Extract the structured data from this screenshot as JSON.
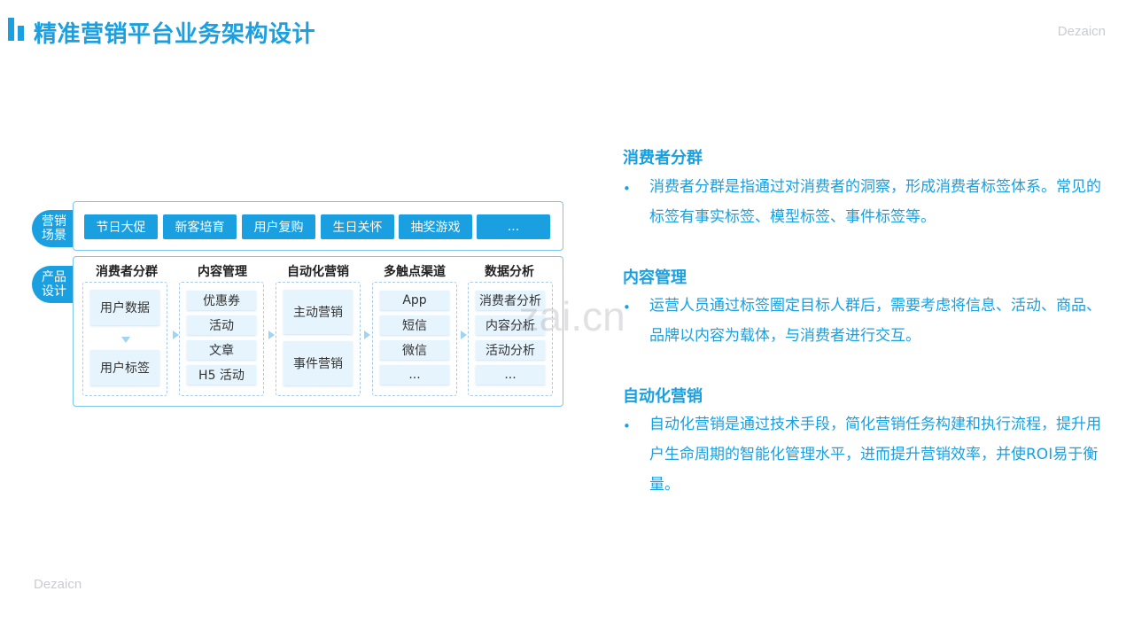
{
  "header": {
    "title": "精准营销平台业务架构设计",
    "brand": "Dezaicn"
  },
  "footer": {
    "brand": "Dezaicn"
  },
  "watermark": "..zai.cn",
  "diagram": {
    "scene_tag": "营销场景",
    "product_tag": "产品设计",
    "scenes": [
      "节日大促",
      "新客培育",
      "用户复购",
      "生日关怀",
      "抽奖游戏",
      "..."
    ],
    "columns": [
      {
        "title": "消费者分群",
        "items": [
          "用户数据",
          "用户标签"
        ]
      },
      {
        "title": "内容管理",
        "items": [
          "优惠券",
          "活动",
          "文章",
          "H5 活动"
        ]
      },
      {
        "title": "自动化营销",
        "items": [
          "主动营销",
          "事件营销"
        ]
      },
      {
        "title": "多触点渠道",
        "items": [
          "App",
          "短信",
          "微信",
          "..."
        ]
      },
      {
        "title": "数据分析",
        "items": [
          "消费者分析",
          "内容分析",
          "活动分析",
          "..."
        ]
      }
    ]
  },
  "sections": [
    {
      "title": "消费者分群",
      "bullet": "•",
      "text": "消费者分群是指通过对消费者的洞察，形成消费者标签体系。常见的标签有事实标签、模型标签、事件标签等。"
    },
    {
      "title": "内容管理",
      "bullet": "•",
      "text": "运营人员通过标签圈定目标人群后，需要考虑将信息、活动、商品、品牌以内容为载体，与消费者进行交互。"
    },
    {
      "title": "自动化营销",
      "bullet": "•",
      "text": "自动化营销是通过技术手段，简化营销任务构建和执行流程，提升用户生命周期的智能化管理水平，进而提升营销效率，并使ROI易于衡量。"
    }
  ],
  "colors": {
    "accent": "#1a9fe0",
    "cell": "#e6f4fd",
    "frame": "#7cc5ec"
  }
}
